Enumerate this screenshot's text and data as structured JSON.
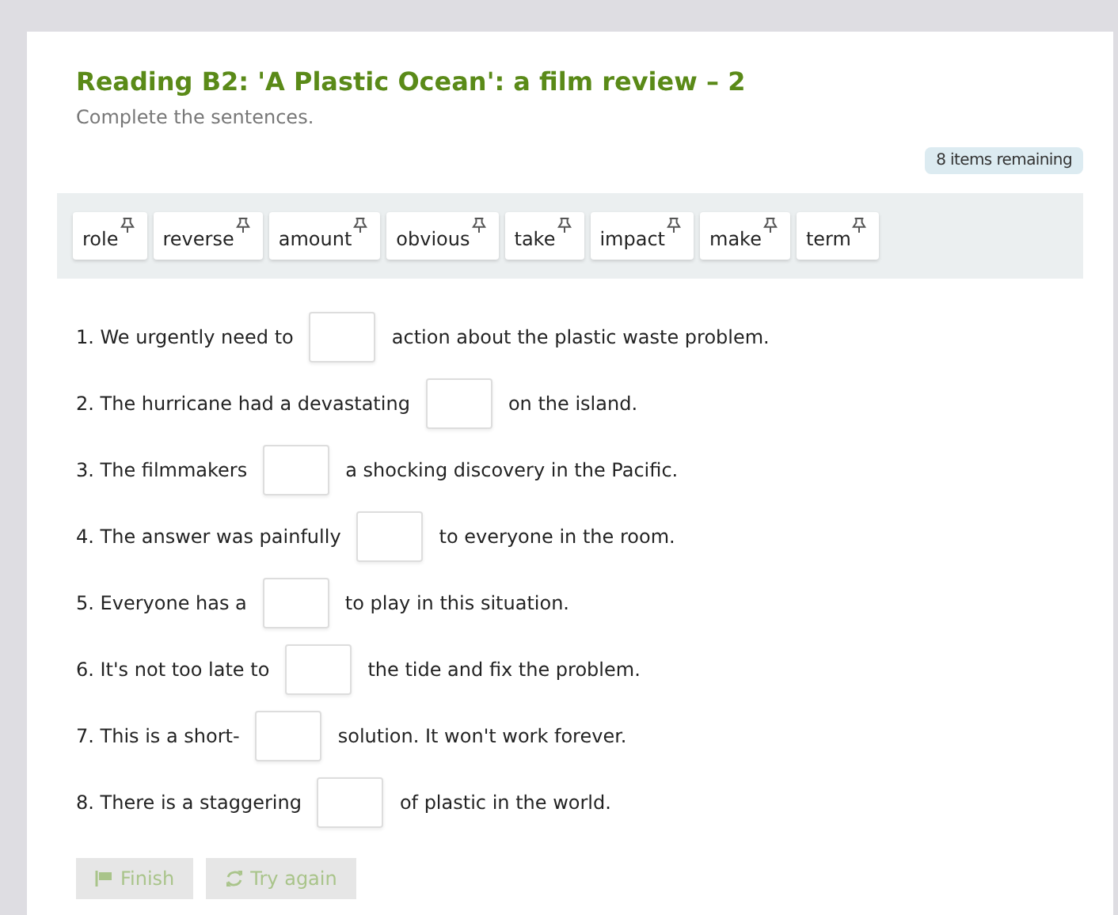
{
  "title": "Reading B2: 'A Plastic Ocean': a film review – 2",
  "instruction": "Complete the sentences.",
  "remaining": "8 items remaining",
  "words": [
    "role",
    "reverse",
    "amount",
    "obvious",
    "take",
    "impact",
    "make",
    "term"
  ],
  "sentences": [
    {
      "before": "1. We urgently need to",
      "after": "action about the plastic waste problem."
    },
    {
      "before": "2. The hurricane had a devastating",
      "after": "on the island."
    },
    {
      "before": "3. The filmmakers",
      "after": "a shocking discovery in the Pacific."
    },
    {
      "before": "4. The answer was painfully",
      "after": "to everyone in the room."
    },
    {
      "before": "5. Everyone has a",
      "after": "to play in this situation."
    },
    {
      "before": "6. It's not too late to",
      "after": "the tide and fix the problem."
    },
    {
      "before": "7. This is a short-",
      "after": "solution. It won't work forever."
    },
    {
      "before": "8. There is a staggering",
      "after": "of plastic in the world."
    }
  ],
  "buttons": [
    {
      "kind": "finish",
      "label": "Finish",
      "disabled": true
    },
    {
      "kind": "retry",
      "label": "Try again",
      "disabled": true
    }
  ]
}
